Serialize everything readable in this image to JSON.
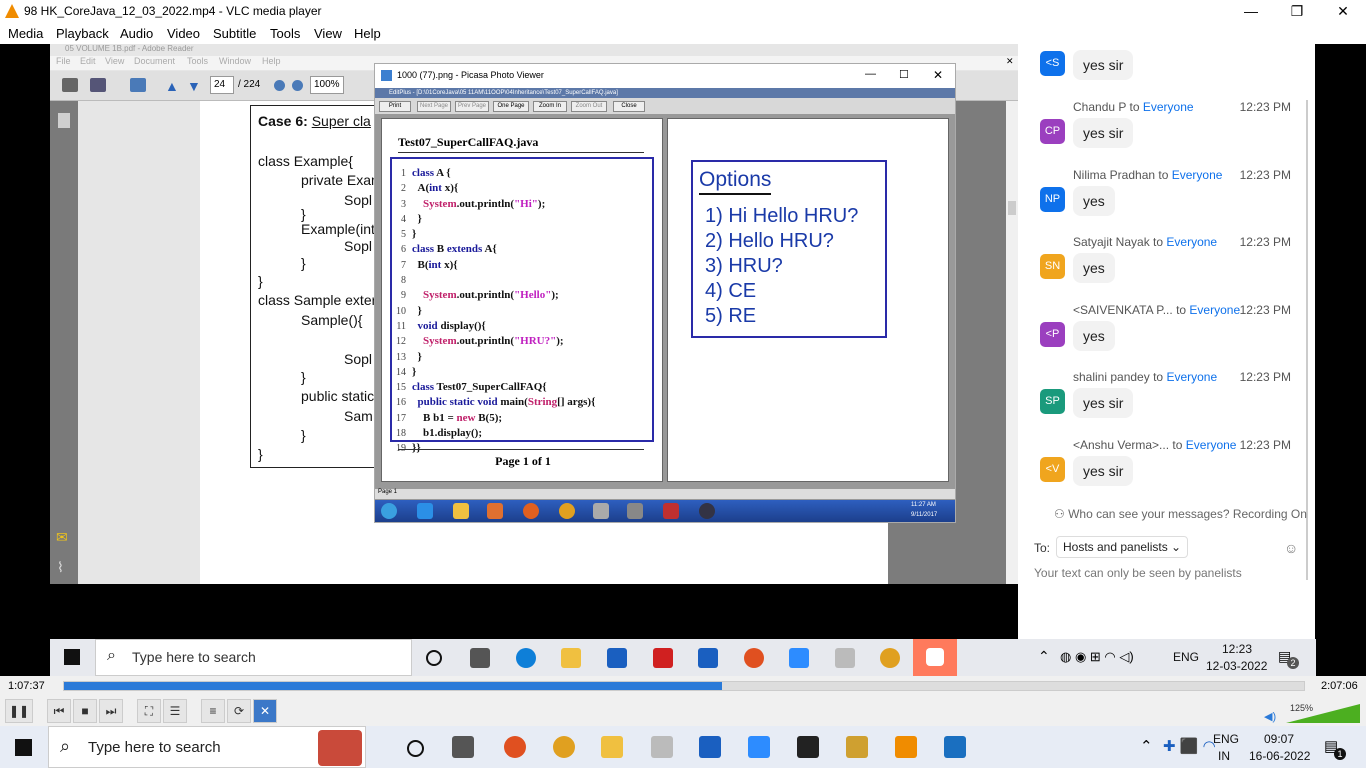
{
  "window": {
    "title": "98 HK_CoreJava_12_03_2022.mp4 - VLC media player",
    "minimize": "—",
    "restore": "❐",
    "close": "✕"
  },
  "menu": [
    "Media",
    "Playback",
    "Audio",
    "Video",
    "Subtitle",
    "Tools",
    "View",
    "Help"
  ],
  "adobe": {
    "title": "05 VOLUME 1B.pdf - Adobe Reader",
    "menu": [
      "File",
      "Edit",
      "View",
      "Document",
      "Tools",
      "Window",
      "Help"
    ],
    "page_current": "24",
    "page_total": "/ 224",
    "zoom": "100%",
    "case_title": "Case 6:",
    "case_title_rest": "Super cla",
    "lines": [
      "class Example{",
      "private Exam",
      "Sopl",
      "}",
      "Example(int",
      "Sopl",
      "}",
      "}",
      "class Sample exter",
      "Sample(){",
      "Sopl",
      "}",
      "public static",
      "Sam",
      "}",
      "}"
    ]
  },
  "picasa": {
    "title": "1000 (77).png - Picasa Photo Viewer",
    "editplus": "EditPlus - [D:\\01CoreJava\\05 11AM\\11OOP\\04Inheritance\\Test07_SuperCallFAQ.java]",
    "buttons": [
      "Print",
      "Next Page",
      "Prev Page",
      "One Page",
      "Zoom In",
      "Zoom Out",
      "Close"
    ],
    "filename": "Test07_SuperCallFAQ.java",
    "code": [
      {
        "n": "1",
        "t": "class A {"
      },
      {
        "n": "2",
        "t": "  A(int x){"
      },
      {
        "n": "3",
        "t": "    System.out.println(\"Hi\");"
      },
      {
        "n": "4",
        "t": "  }"
      },
      {
        "n": "5",
        "t": "}"
      },
      {
        "n": "6",
        "t": "class B extends A{"
      },
      {
        "n": "7",
        "t": "  B(int x){"
      },
      {
        "n": "8",
        "t": ""
      },
      {
        "n": "9",
        "t": "    System.out.println(\"Hello\");"
      },
      {
        "n": "10",
        "t": "  }"
      },
      {
        "n": "11",
        "t": "  void display(){"
      },
      {
        "n": "12",
        "t": "    System.out.println(\"HRU?\");"
      },
      {
        "n": "13",
        "t": "  }"
      },
      {
        "n": "14",
        "t": "}"
      },
      {
        "n": "15",
        "t": "class Test07_SuperCallFAQ{"
      },
      {
        "n": "16",
        "t": "  public static void main(String[] args){"
      },
      {
        "n": "17",
        "t": "    B b1 = new B(5);"
      },
      {
        "n": "18",
        "t": "    b1.display();"
      },
      {
        "n": "19",
        "t": "}}"
      }
    ],
    "page_label": "Page 1 of 1",
    "options_title": "Options",
    "options": [
      "1) Hi Hello HRU?",
      "2) Hello HRU?",
      "3) HRU?",
      "4) CE",
      "5) RE"
    ],
    "status": "Page 1",
    "xp_time": "11:27 AM",
    "xp_date": "9/11/2017"
  },
  "chat": {
    "messages": [
      {
        "initials": "<S",
        "color": "#0e71eb",
        "name": "",
        "to": "",
        "time": "",
        "text": "yes sir"
      },
      {
        "initials": "CP",
        "color": "#9b3fbf",
        "name": "Chandu P",
        "to": "to",
        "everyone": "Everyone",
        "time": "12:23 PM",
        "text": "yes sir"
      },
      {
        "initials": "NP",
        "color": "#0e71eb",
        "name": "Nilima Pradhan",
        "to": "to",
        "everyone": "Everyone",
        "time": "12:23 PM",
        "text": "yes"
      },
      {
        "initials": "SN",
        "color": "#f0a51e",
        "name": "Satyajit Nayak",
        "to": "to",
        "everyone": "Everyone",
        "time": "12:23 PM",
        "text": "yes"
      },
      {
        "initials": "<P",
        "color": "#9b3fbf",
        "name": "<SAIVENKATA P...",
        "to": "to",
        "everyone": "Everyone",
        "time": "12:23 PM",
        "text": "yes"
      },
      {
        "initials": "SP",
        "color": "#1a9a7c",
        "name": "shalini pandey",
        "to": "to",
        "everyone": "Everyone",
        "time": "12:23 PM",
        "text": "yes sir"
      },
      {
        "initials": "<V",
        "color": "#f0a51e",
        "name": "<Anshu Verma>...",
        "to": "to",
        "everyone": "Everyone",
        "time": "12:23 PM",
        "text": "yes sir"
      }
    ],
    "info": "Who can see your messages? Recording On",
    "to_label": "To:",
    "recipient": "Hosts and panelists ⌄",
    "hint": "Your text can only be seen by panelists"
  },
  "inner_taskbar": {
    "search_placeholder": "Type here to search",
    "lang": "ENG",
    "time": "12:23",
    "date": "12-03-2022",
    "notif": "2"
  },
  "vlc": {
    "elapsed": "1:07:37",
    "total": "2:07:06",
    "progress": 0.531,
    "volume": "125%"
  },
  "outer_taskbar": {
    "search_placeholder": "Type here to search",
    "lang": "ENG",
    "region": "IN",
    "time": "09:07",
    "date": "16-06-2022",
    "notif": "1"
  }
}
